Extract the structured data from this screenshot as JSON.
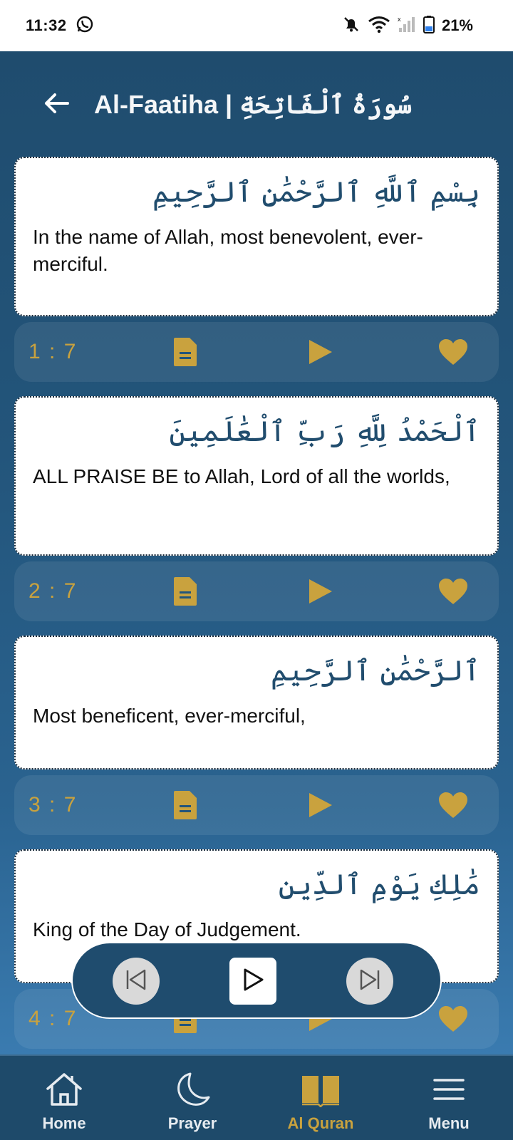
{
  "status_bar": {
    "time": "11:32",
    "battery": "21%",
    "icons": [
      "whatsapp-icon",
      "bell-off-icon",
      "wifi-icon",
      "signal-icon",
      "battery-icon"
    ]
  },
  "header": {
    "title": "Al-Faatiha | سُورَةُ ٱلْفَاتِحَةِ",
    "back_icon": "arrow-left-icon"
  },
  "colors": {
    "accent_gold": "#c9a23e",
    "primary_blue": "#1f4c6e",
    "arabic_text": "#214d6e"
  },
  "verses": [
    {
      "arabic": "بِسْمِ ٱللَّهِ ٱلرَّحْمَٰنِ ٱلرَّحِيمِ",
      "translation": "In the name of Allah, most benevolent, ever-merciful.",
      "number": "1 : 7"
    },
    {
      "arabic": "ٱلْحَمْدُ لِلَّهِ رَبِّ ٱلْعَٰلَمِينَ",
      "translation": "ALL PRAISE BE to Allah, Lord of all the worlds,",
      "number": "2 : 7"
    },
    {
      "arabic": "ٱلرَّحْمَٰنِ ٱلرَّحِيمِ",
      "translation": "Most beneficent, ever-merciful,",
      "number": "3 : 7"
    },
    {
      "arabic": "مَٰلِكِ يَوْمِ ٱلدِّينِ",
      "translation": "King of the Day of Judgement.",
      "number": "4 : 7"
    }
  ],
  "player": {
    "prev_icon": "skip-previous-icon",
    "play_icon": "play-icon",
    "next_icon": "skip-next-icon"
  },
  "bottom_nav": [
    {
      "label": "Home",
      "icon": "home-icon"
    },
    {
      "label": "Prayer",
      "icon": "moon-icon"
    },
    {
      "label": "Al Quran",
      "icon": "book-icon",
      "active": true
    },
    {
      "label": "Menu",
      "icon": "menu-icon"
    }
  ]
}
